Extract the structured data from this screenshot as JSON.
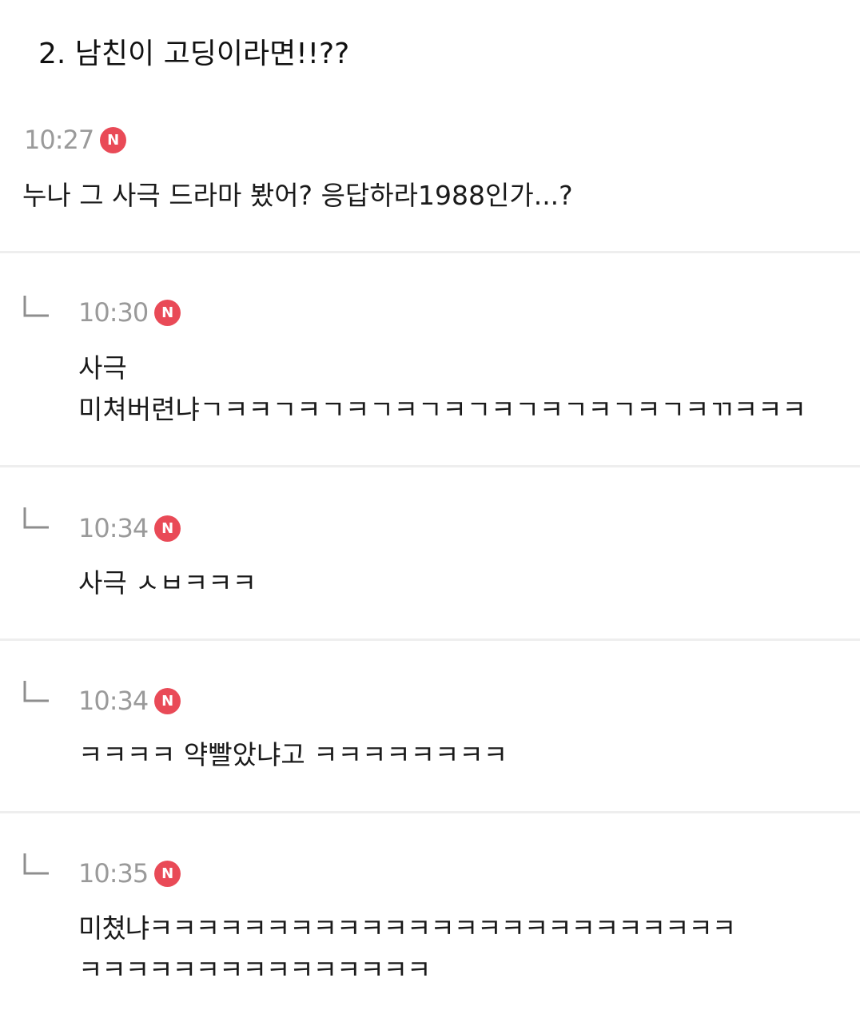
{
  "title": "2. 남친이 고딩이라면!!??",
  "badge_label": "N",
  "comments": [
    {
      "time": "10:27",
      "lines": [
        "누나 그 사극 드라마 봤어? 응답하라1988인가...?"
      ]
    },
    {
      "time": "10:30",
      "lines": [
        "사극",
        "미쳐버련냐ㄱㅋㅋㄱㅋㄱㅋㄱㅋㄱㅋㄱㅋㄱㅋㄱㅋㄱㅋㄱㅋㄲㅋㅋㅋ"
      ]
    },
    {
      "time": "10:34",
      "lines": [
        "사극 ㅅㅂㅋㅋㅋ"
      ]
    },
    {
      "time": "10:34",
      "lines": [
        "ㅋㅋㅋㅋ 약빨았냐고 ㅋㅋㅋㅋㅋㅋㅋㅋ"
      ]
    },
    {
      "time": "10:35",
      "lines": [
        "미쳤냐ㅋㅋㅋㅋㅋㅋㅋㅋㅋㅋㅋㅋㅋㅋㅋㅋㅋㅋㅋㅋㅋㅋㅋㅋㅋ",
        "ㅋㅋㅋㅋㅋㅋㅋㅋㅋㅋㅋㅋㅋㅋㅋ"
      ]
    }
  ],
  "colors": {
    "badge": "#e94a57",
    "time": "#9a9a9a",
    "divider": "#eeeeee"
  },
  "icons": {
    "reply": "reply-arrow-icon",
    "new": "new-badge-icon"
  }
}
